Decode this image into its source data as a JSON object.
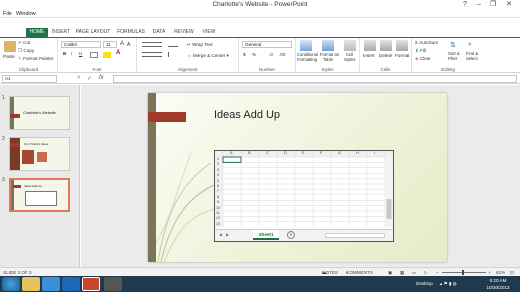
{
  "window": {
    "title": "Charlotte's Website - PowerPoint",
    "controls": [
      "?",
      "–",
      "❐",
      "✕"
    ]
  },
  "menubar": {
    "items": [
      "File",
      "Window"
    ]
  },
  "ribbon_tabs": {
    "items": [
      "HOME",
      "INSERT",
      "PAGE LAYOUT",
      "FORMULAS",
      "DATA",
      "REVIEW",
      "VIEW"
    ],
    "active": "HOME"
  },
  "ribbon": {
    "clipboard": {
      "paste": "Paste",
      "cut": "Cut",
      "copy": "Copy",
      "format_painter": "Format Painter",
      "label": "Clipboard"
    },
    "font": {
      "name": "Calibri",
      "size": "11",
      "bold": "B",
      "italic": "I",
      "underline": "U",
      "grow": "A",
      "shrink": "A",
      "font_color": "A",
      "label": "Font"
    },
    "alignment": {
      "wrap": "Wrap Text",
      "merge": "Merge & Center",
      "label": "Alignment"
    },
    "number": {
      "format": "General",
      "currency": "$",
      "percent": "%",
      "comma": ",",
      "dec_inc": ".0",
      "dec_dec": ".00",
      "label": "Number"
    },
    "styles": {
      "conditional": "Conditional",
      "conditional2": "Formatting",
      "format_as": "Format as",
      "table": "Table",
      "cell": "Cell",
      "styles_btn": "Styles",
      "label": "Styles"
    },
    "cells": {
      "insert": "Insert",
      "delete": "Delete",
      "format": "Format",
      "label": "Cells"
    },
    "editing": {
      "autosum": "AutoSum",
      "fill": "Fill",
      "clear": "Clear",
      "sort": "Sort &",
      "filter": "Filter",
      "find": "Find &",
      "select": "Select",
      "label": "Editing"
    }
  },
  "formula_bar": {
    "name_box": "A1",
    "fx": "fx",
    "x": "×",
    "check": "✓"
  },
  "slides_panel": {
    "slides": [
      {
        "num": "1",
        "title": "Charlotte's Website"
      },
      {
        "num": "2",
        "title": "Our Product Ideas"
      },
      {
        "num": "3",
        "title": "Ideas Add Up"
      }
    ],
    "selected": "3"
  },
  "slide": {
    "title": "Ideas Add Up"
  },
  "worksheet": {
    "columns": [
      "A",
      "B",
      "C",
      "D",
      "E",
      "F",
      "G",
      "H",
      "I"
    ],
    "rows": [
      "1",
      "2",
      "3",
      "4",
      "5",
      "6",
      "7",
      "8",
      "9",
      "10",
      "11",
      "12",
      "13"
    ],
    "sheet_tab": "Sheet1",
    "add_sheet": "+"
  },
  "statusbar": {
    "slide_info": "SLIDE 3 OF 3",
    "notes": "NOTES",
    "comments": "COMMENTS",
    "zoom": "62%"
  },
  "taskbar": {
    "tray_left": "Desktop",
    "time": "6:20 AM",
    "date": "10/30/2013"
  },
  "colors": {
    "accent": "#217346",
    "slide_accent": "#a03a2a",
    "selection": "#e07a5f",
    "taskbar": "#1e3a4c"
  }
}
